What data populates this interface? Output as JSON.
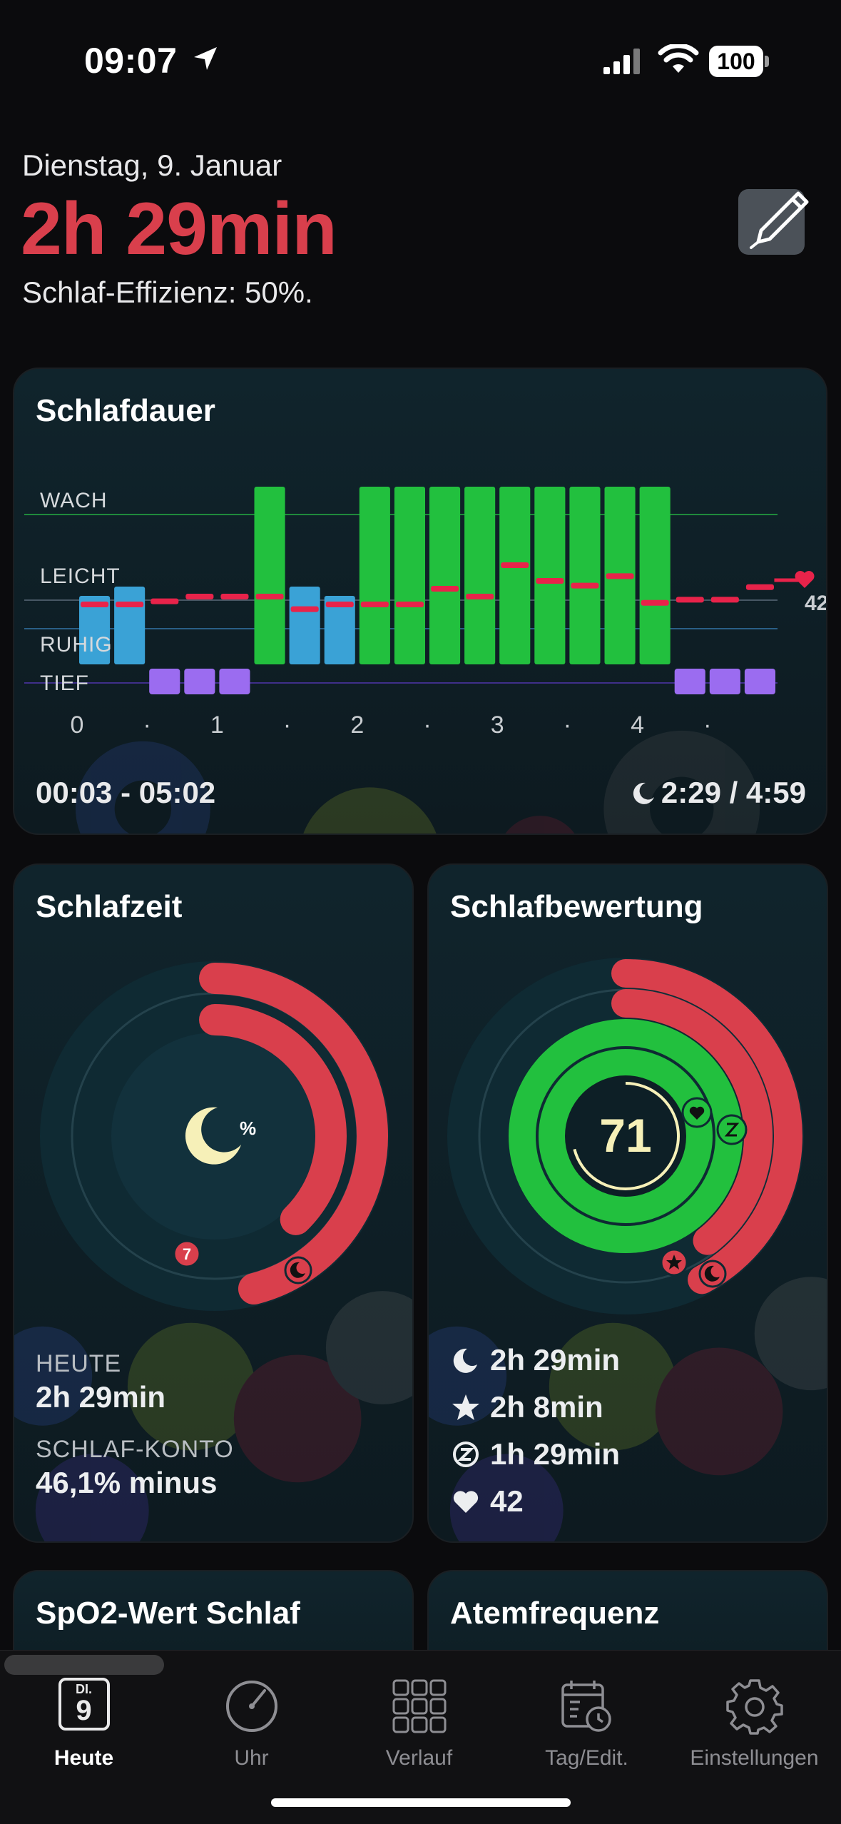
{
  "status_bar": {
    "time": "09:07",
    "battery": "100"
  },
  "header": {
    "date": "Dienstag, 9. Januar",
    "duration": "2h 29min",
    "efficiency": "Schlaf-Effizienz: 50%."
  },
  "colors": {
    "accent_red": "#d93f4c",
    "awake_green": "#22c03e",
    "light_blue": "#3aa2d6",
    "deep_purple": "#9b6cf0",
    "heart_line": "#e8234a"
  },
  "sleep_duration": {
    "title": "Schlafdauer",
    "stage_labels": [
      "WACH",
      "LEICHT",
      "RUHIG",
      "TIEF"
    ],
    "x_ticks": [
      "0",
      "·",
      "1",
      "·",
      "2",
      "·",
      "3",
      "·",
      "4",
      "·"
    ],
    "heart_rate_current": "42",
    "time_range": "00:03 - 05:02",
    "sleep_ratio": "2:29 / 4:59",
    "chart_data": {
      "type": "bar",
      "xlabel": "",
      "ylabel": "",
      "x_range_hours": [
        0,
        5
      ],
      "y_levels": [
        "TIEF",
        "RUHIG",
        "LEICHT",
        "WACH"
      ],
      "bins_stage": [
        "RUHIG",
        "RUHIG",
        "TIEF",
        "TIEF",
        "TIEF",
        "WACH",
        "RUHIG",
        "RUHIG",
        "WACH",
        "WACH",
        "WACH",
        "WACH",
        "WACH",
        "WACH",
        "WACH",
        "WACH",
        "WACH",
        "TIEF",
        "TIEF",
        "TIEF"
      ],
      "bin_minutes": 15,
      "heart_rate_relative": [
        0.5,
        0.5,
        0.52,
        0.55,
        0.55,
        0.55,
        0.47,
        0.5,
        0.5,
        0.5,
        0.6,
        0.55,
        0.75,
        0.65,
        0.62,
        0.68,
        0.51,
        0.53,
        0.53,
        0.61
      ]
    }
  },
  "sleep_time": {
    "title": "Schlafzeit",
    "center_symbol": "%",
    "badge": "7",
    "today_label": "HEUTE",
    "today_value": "2h 29min",
    "account_label": "SCHLAF-KONTO",
    "account_value": "46,1% minus",
    "ring_fill_fraction": 0.46
  },
  "sleep_score": {
    "title": "Schlafbewertung",
    "score": "71",
    "score_fraction": 0.71,
    "rows": [
      {
        "icon": "moon-icon",
        "value": "2h 29min"
      },
      {
        "icon": "star-icon",
        "value": "2h 8min"
      },
      {
        "icon": "z-icon",
        "value": "1h 29min"
      },
      {
        "icon": "heart-icon",
        "value": "42"
      }
    ]
  },
  "spo2": {
    "title": "SpO2-Wert Schlaf"
  },
  "respiration": {
    "title": "Atemfrequenz"
  },
  "tabs": [
    {
      "label": "Heute",
      "icon": "calendar-day-icon",
      "dow": "DI.",
      "day": "9",
      "active": true
    },
    {
      "label": "Uhr",
      "icon": "gauge-icon"
    },
    {
      "label": "Verlauf",
      "icon": "grid-icon"
    },
    {
      "label": "Tag/Edit.",
      "icon": "calendar-clock-icon"
    },
    {
      "label": "Einstellungen",
      "icon": "gear-icon"
    }
  ]
}
